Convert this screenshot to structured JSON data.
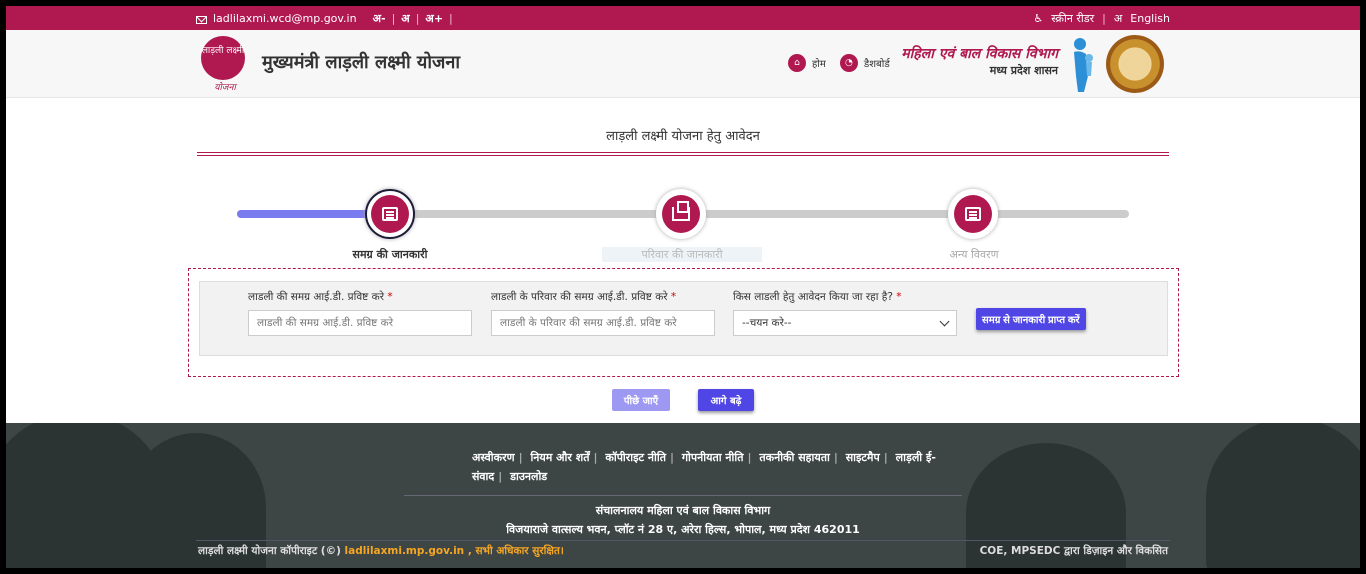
{
  "topbar": {
    "email": "ladlilaxmi.wcd@mp.gov.in",
    "font_decrease": "अ-",
    "font_normal": "अ",
    "font_increase": "अ+",
    "screen_reader": "स्क्रीन रीडर",
    "language": "English"
  },
  "header": {
    "logo_text": "लाड़ली लक्ष्मी",
    "logo_script": "योजना",
    "site_title": "मुख्यमंत्री लाड़ली लक्ष्मी योजना",
    "nav_home": "होम",
    "nav_dashboard": "डैशबोर्ड",
    "dept_line1": "महिला एवं बाल विकास विभाग",
    "dept_line2": "मध्य प्रदेश शासन"
  },
  "form": {
    "title": "लाड़ली लक्ष्मी योजना हेतु आवेदन",
    "steps": [
      {
        "label": "समग्र की जानकारी"
      },
      {
        "label": "परिवार की जानकारी"
      },
      {
        "label": "अन्य विवरण"
      }
    ],
    "field1_label": "लाडली की समग्र आई.डी. प्रविष्ट करे",
    "field1_placeholder": "लाडली की समग्र आई.डी. प्रविष्ट करे",
    "field2_label": "लाडली के परिवार की समग्र आई.डी. प्रविष्ट करे",
    "field2_placeholder": "लाडली के परिवार की समग्र आई.डी. प्रविष्ट करे",
    "field3_label": "किस लाडली हेतु आवेदन किया जा रहा है?",
    "field3_value": "--चयन करे--",
    "required_mark": "*",
    "fetch_button": "समग्र से जानकारी प्राप्त करें",
    "back_button": "पीछे जाएँ",
    "next_button": "आगे बढ़े"
  },
  "footer": {
    "links": [
      "अस्वीकरण",
      "नियम और शर्तें",
      "कॉपीराइट नीति",
      "गोपनीयता नीति",
      "तकनीकी सहायता",
      "साइटमैप",
      "लाड़ली ई-संवाद",
      "डाउनलोड"
    ],
    "address_line1": "संचालनालय महिला एवं बाल विकास विभाग",
    "address_line2": "विजयाराजे वात्सल्य भवन, प्लॉट नं 28 ए, अरेरा हिल्स, भोपाल, मध्य प्रदेश 462011",
    "copyright_prefix": "लाड़ली लक्ष्मी योजना कॉपीराइट (©)",
    "copyright_link": "ladlilaxmi.mp.gov.in , सभी अधिकार सुरक्षित।",
    "credit": "COE, MPSEDC द्वारा डिज़ाइन और विकसित"
  },
  "colors": {
    "brand": "#b0194f",
    "primary_button": "#5046e5",
    "progress_active": "#7b7bf0",
    "progress_inactive": "#cccccc",
    "footer_bg": "#3e4545"
  },
  "progress": {
    "completed_fraction": 0.17
  }
}
